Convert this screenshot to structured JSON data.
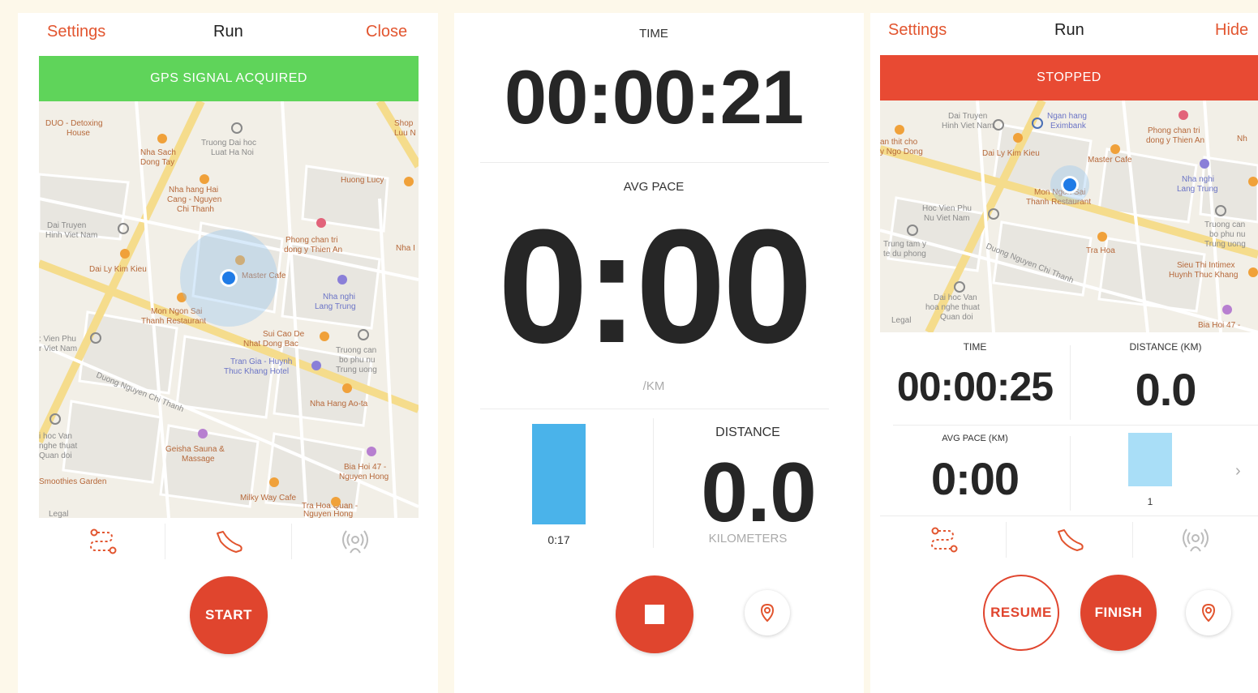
{
  "colors": {
    "accent": "#e0452e",
    "gps_green": "#5fd45a",
    "stopped_red": "#e84a33",
    "bar_blue": "#4ab3ea",
    "bar_light_blue": "#a9def7",
    "location_dot": "#1f7be6"
  },
  "screen1": {
    "nav": {
      "left": "Settings",
      "title": "Run",
      "right": "Close"
    },
    "banner": "GPS SIGNAL ACQUIRED",
    "map": {
      "legal": "Legal",
      "places": [
        "DUO - Detoxing House",
        "Truong Dai hoc Luat Ha Noi",
        "Nha Sach Dong Tay",
        "Nha hang Hai Cang - Nguyen Chi Thanh",
        "Huong Lucy",
        "Dai Truyen Hinh Viet Nam",
        "Dai Ly Kim Kieu",
        "Phong chan tri dong y Thien An",
        "Master Cafe",
        "Mon Ngon Sai Thanh Restaurant",
        "Nha nghi Lang Trung",
        "Sui Cao De Nhat Dong Bac",
        "Truong can bo phu nu Trung uong",
        "Tran Gia - Huynh Thuc Khang Hotel",
        "Nha Hang Ao-ta",
        "Geisha Sauna & Massage",
        "Bia Hoi 47 - Nguyen Hong",
        "Smoothies Garden",
        "Milky Way Cafe",
        "Tra Hoa Quan - Nguyen Hong",
        "Duong Nguyen Chi Thanh"
      ]
    },
    "tabs": [
      "route-icon",
      "shoe-icon",
      "beacon-icon"
    ],
    "start_label": "START"
  },
  "screen2": {
    "time_label": "TIME",
    "time_value": "00:00:21",
    "avg_pace_label": "AVG PACE",
    "avg_pace_value": "0:00",
    "pace_unit": "/KM",
    "split_bar_label": "0:17",
    "distance_label": "DISTANCE",
    "distance_value": "0.0",
    "distance_unit": "KILOMETERS"
  },
  "screen3": {
    "nav": {
      "left": "Settings",
      "title": "Run",
      "right": "Hide"
    },
    "banner": "STOPPED",
    "map": {
      "legal": "Legal",
      "places": [
        "Dai Truyen Hinh Viet Nam",
        "Ngan hang Eximbank",
        "Phong chan tri dong y Thien An",
        "Dai Ly Kim Kieu",
        "Master Cafe",
        "Nha nghi Lang Trung",
        "Mon Ngon Sai Thanh Restaurant",
        "Hoc Vien Phu Nu Viet Nam",
        "Truong can bo phu nu Trung uong",
        "Trung tam y te du phong",
        "Tra Hoa",
        "Sieu Thi Intimex Huynh Thuc Khang",
        "Dai hoc Van hoa nghe thuat Quan doi",
        "Bia Hoi 47",
        "Duong Nguyen Chi Thanh"
      ]
    },
    "time_label": "TIME",
    "time_value": "00:00:25",
    "distance_label": "DISTANCE (KM)",
    "distance_value": "0.0",
    "avg_pace_label": "AVG PACE (KM)",
    "avg_pace_value": "0:00",
    "split_index": "1",
    "resume_label": "RESUME",
    "finish_label": "FINISH"
  }
}
